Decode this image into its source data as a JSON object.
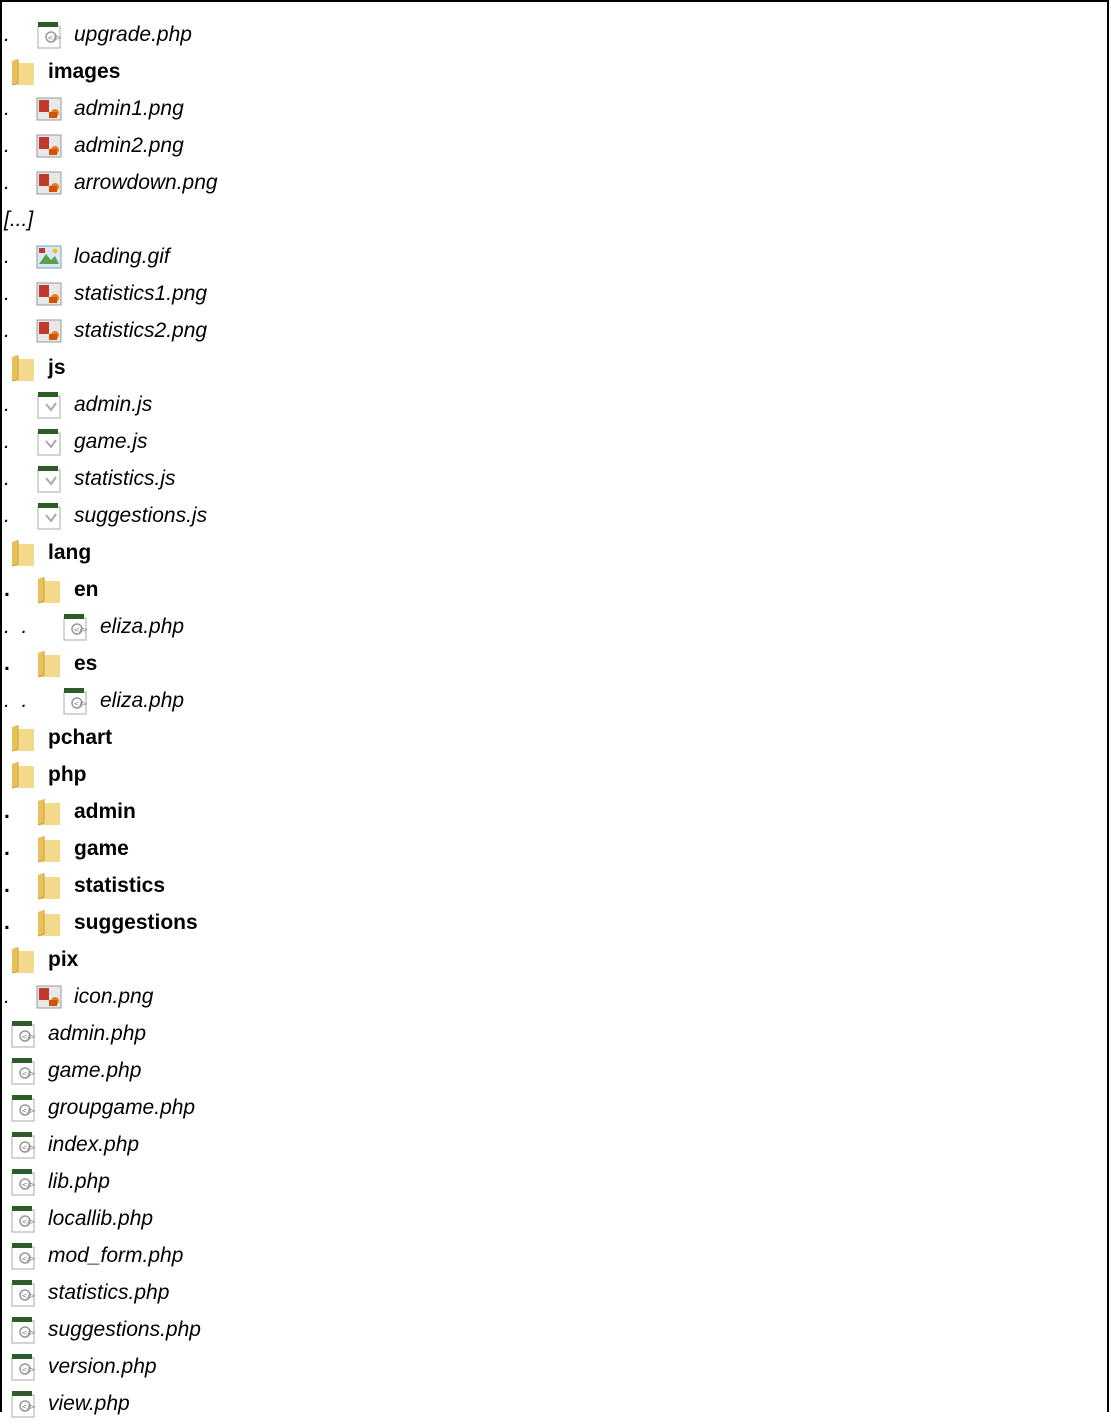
{
  "rows": [
    {
      "indent": 1,
      "kind": "file",
      "icon": "php-file-icon",
      "name": "upgrade.php"
    },
    {
      "indent": 0,
      "kind": "folder",
      "icon": "folder-icon",
      "name": "images"
    },
    {
      "indent": 1,
      "kind": "file",
      "icon": "png-image-icon",
      "name": "admin1.png"
    },
    {
      "indent": 1,
      "kind": "file",
      "icon": "png-image-icon",
      "name": "admin2.png"
    },
    {
      "indent": 1,
      "kind": "file",
      "icon": "png-image-icon",
      "name": "arrowdown.png"
    },
    {
      "indent": 0,
      "kind": "ellipsis",
      "icon": "",
      "name": "[...]"
    },
    {
      "indent": 1,
      "kind": "file",
      "icon": "gif-image-icon",
      "name": "loading.gif"
    },
    {
      "indent": 1,
      "kind": "file",
      "icon": "png-image-icon",
      "name": "statistics1.png"
    },
    {
      "indent": 1,
      "kind": "file",
      "icon": "png-image-icon",
      "name": "statistics2.png"
    },
    {
      "indent": 0,
      "kind": "folder",
      "icon": "folder-icon",
      "name": "js"
    },
    {
      "indent": 1,
      "kind": "file",
      "icon": "js-file-icon",
      "name": "admin.js"
    },
    {
      "indent": 1,
      "kind": "file",
      "icon": "js-file-icon",
      "name": "game.js"
    },
    {
      "indent": 1,
      "kind": "file",
      "icon": "js-file-icon",
      "name": "statistics.js"
    },
    {
      "indent": 1,
      "kind": "file",
      "icon": "js-file-icon",
      "name": "suggestions.js"
    },
    {
      "indent": 0,
      "kind": "folder",
      "icon": "folder-icon",
      "name": "lang"
    },
    {
      "indent": 1,
      "kind": "folder",
      "icon": "folder-icon",
      "name": "en"
    },
    {
      "indent": 2,
      "kind": "file",
      "icon": "php-file-icon",
      "name": "eliza.php"
    },
    {
      "indent": 1,
      "kind": "folder",
      "icon": "folder-icon",
      "name": "es"
    },
    {
      "indent": 2,
      "kind": "file",
      "icon": "php-file-icon",
      "name": "eliza.php"
    },
    {
      "indent": 0,
      "kind": "folder",
      "icon": "folder-icon",
      "name": "pchart"
    },
    {
      "indent": 0,
      "kind": "folder",
      "icon": "folder-icon",
      "name": "php"
    },
    {
      "indent": 1,
      "kind": "folder",
      "icon": "folder-icon",
      "name": "admin"
    },
    {
      "indent": 1,
      "kind": "folder",
      "icon": "folder-icon",
      "name": "game"
    },
    {
      "indent": 1,
      "kind": "folder",
      "icon": "folder-icon",
      "name": "statistics"
    },
    {
      "indent": 1,
      "kind": "folder",
      "icon": "folder-icon",
      "name": "suggestions"
    },
    {
      "indent": 0,
      "kind": "folder",
      "icon": "folder-icon",
      "name": "pix"
    },
    {
      "indent": 1,
      "kind": "file",
      "icon": "png-image-icon",
      "name": "icon.png"
    },
    {
      "indent": 0,
      "kind": "file",
      "icon": "php-file-icon",
      "name": "admin.php"
    },
    {
      "indent": 0,
      "kind": "file",
      "icon": "php-file-icon",
      "name": "game.php"
    },
    {
      "indent": 0,
      "kind": "file",
      "icon": "php-file-icon",
      "name": "groupgame.php"
    },
    {
      "indent": 0,
      "kind": "file",
      "icon": "php-file-icon",
      "name": "index.php"
    },
    {
      "indent": 0,
      "kind": "file",
      "icon": "php-file-icon",
      "name": "lib.php"
    },
    {
      "indent": 0,
      "kind": "file",
      "icon": "php-file-icon",
      "name": "locallib.php"
    },
    {
      "indent": 0,
      "kind": "file",
      "icon": "php-file-icon",
      "name": "mod_form.php"
    },
    {
      "indent": 0,
      "kind": "file",
      "icon": "php-file-icon",
      "name": "statistics.php"
    },
    {
      "indent": 0,
      "kind": "file",
      "icon": "php-file-icon",
      "name": "suggestions.php"
    },
    {
      "indent": 0,
      "kind": "file",
      "icon": "php-file-icon",
      "name": "version.php"
    },
    {
      "indent": 0,
      "kind": "file",
      "icon": "php-file-icon",
      "name": "view.php"
    }
  ],
  "dot_char": "."
}
